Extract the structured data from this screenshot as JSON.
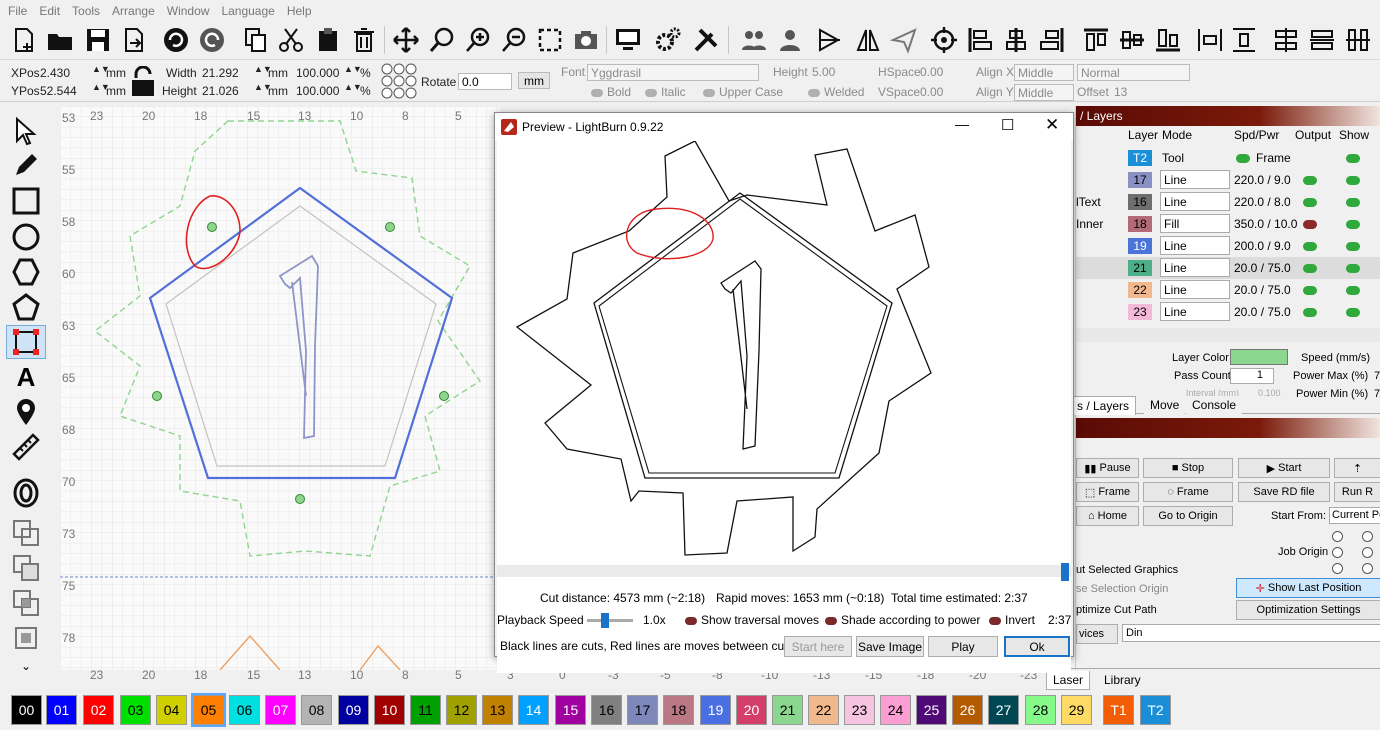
{
  "menu": [
    "File",
    "Edit",
    "Tools",
    "Arrange",
    "Window",
    "Language",
    "Help"
  ],
  "props": {
    "xpos_label": "XPos",
    "xpos": "2.430",
    "ypos_label": "YPos",
    "ypos": "52.544",
    "unit_mm": "mm",
    "width_label": "Width",
    "width": "21.292",
    "height_label": "Height",
    "height": "21.026",
    "scale_w": "100.000",
    "scale_h": "100.000",
    "pct": "%",
    "rotate_label": "Rotate",
    "rotate": "0.0",
    "mm_btn": "mm",
    "font_label": "Font",
    "font": "Yggdrasil",
    "fheight_label": "Height",
    "fheight": "5.00",
    "hspace_label": "HSpace",
    "hspace": "0.00",
    "vspace_label": "VSpace",
    "vspace": "0.00",
    "alignx_label": "Align X",
    "alignx": "Middle",
    "aligny_label": "Align Y",
    "aligny": "Middle",
    "normal": "Normal",
    "offset_label": "Offset",
    "offset": "13",
    "bold": "Bold",
    "italic": "Italic",
    "upper": "Upper Case",
    "welded": "Welded"
  },
  "ruler_top": [
    "23",
    "20",
    "18",
    "15",
    "13",
    "10",
    "8",
    "5"
  ],
  "ruler_top_bottom": [
    "23",
    "20",
    "18",
    "15",
    "13",
    "10",
    "8",
    "5",
    "3",
    "0",
    "-3",
    "-5",
    "-8",
    "-10",
    "-13",
    "-15",
    "-18",
    "-20",
    "-23"
  ],
  "ruler_left": [
    "53",
    "55",
    "58",
    "60",
    "63",
    "65",
    "68",
    "70",
    "73",
    "75",
    "78"
  ],
  "preview": {
    "title": "Preview - LightBurn 0.9.22",
    "cut_distance": "Cut distance: 4573 mm (~2:18)",
    "rapid": "Rapid moves: 1653 mm (~0:18)",
    "total": "Total time estimated: 2:37",
    "playback_label": "Playback Speed",
    "speed": "1.0x",
    "show_traversal": "Show traversal moves",
    "shade": "Shade according to power",
    "invert": "Invert",
    "time": "2:37",
    "legend": "Black lines are cuts, Red lines are moves between cuts",
    "start_here": "Start here",
    "save_image": "Save Image",
    "play": "Play",
    "ok": "Ok"
  },
  "layers": {
    "title": "/ Layers",
    "headers": [
      "Layer",
      "Mode",
      "Spd/Pwr",
      "Output",
      "Show"
    ],
    "rows": [
      {
        "name": "",
        "layer": "T2",
        "mode": "Tool",
        "spd": "Frame",
        "color": "#1a8fd8",
        "txt": "#fff"
      },
      {
        "name": "",
        "layer": "17",
        "mode": "Line",
        "spd": "220.0 / 9.0",
        "color": "#8a8fc4",
        "txt": "#000"
      },
      {
        "name": "lText",
        "layer": "16",
        "mode": "Line",
        "spd": "220.0 / 8.0",
        "color": "#6e6e6e",
        "txt": "#000"
      },
      {
        "name": "Inner",
        "layer": "18",
        "mode": "Fill",
        "spd": "350.0 / 10.0",
        "color": "#b36b7a",
        "txt": "#000"
      },
      {
        "name": "",
        "layer": "19",
        "mode": "Line",
        "spd": "200.0 / 9.0",
        "color": "#4a74d8",
        "txt": "#fff"
      },
      {
        "name": "",
        "layer": "21",
        "mode": "Line",
        "spd": "20.0 / 75.0",
        "color": "#4fae8a",
        "txt": "#000"
      },
      {
        "name": "",
        "layer": "22",
        "mode": "Line",
        "spd": "20.0 / 75.0",
        "color": "#f2b98e",
        "txt": "#000"
      },
      {
        "name": "",
        "layer": "23",
        "mode": "Line",
        "spd": "20.0 / 75.0",
        "color": "#f2b9d8",
        "txt": "#000"
      }
    ],
    "layer_color": "Layer Color",
    "speed": "Speed (mm/s)",
    "pass_count": "Pass Count",
    "pass": "1",
    "power_max": "Power Max (%)",
    "power_min": "Power Min (%)",
    "pmax": "7",
    "pmin": "7",
    "interval": "Interval (mm)",
    "interval_val": "0.100"
  },
  "tabs1": [
    "s / Layers",
    "Move",
    "Console"
  ],
  "laser": {
    "pause": "Pause",
    "stop": "Stop",
    "start": "Start",
    "frame1": "Frame",
    "frame2": "Frame",
    "save_rd": "Save RD file",
    "run_rd": "Run R",
    "home": "Home",
    "go_origin": "Go to Origin",
    "start_from": "Start From:",
    "start_from_val": "Current Po",
    "job_origin": "Job Origin",
    "cut_selected": "ut Selected Graphics",
    "use_sel": "se Selection Origin",
    "show_last": "Show Last Position",
    "optimize": "ptimize Cut Path",
    "opt_settings": "Optimization Settings",
    "devices": "vices",
    "device_val": "Din"
  },
  "tabs2": [
    "Laser",
    "Library"
  ],
  "palette": [
    {
      "l": "00",
      "c": "#000000",
      "t": "#fff"
    },
    {
      "l": "01",
      "c": "#0000ff",
      "t": "#fff"
    },
    {
      "l": "02",
      "c": "#ff0000",
      "t": "#fff"
    },
    {
      "l": "03",
      "c": "#00e000",
      "t": "#000"
    },
    {
      "l": "04",
      "c": "#d0d000",
      "t": "#000"
    },
    {
      "l": "05",
      "c": "#ff8000",
      "t": "#000"
    },
    {
      "l": "06",
      "c": "#00e0e0",
      "t": "#000"
    },
    {
      "l": "07",
      "c": "#ff00ff",
      "t": "#fff"
    },
    {
      "l": "08",
      "c": "#b4b4b4",
      "t": "#000"
    },
    {
      "l": "09",
      "c": "#0000a0",
      "t": "#fff"
    },
    {
      "l": "10",
      "c": "#a00000",
      "t": "#fff"
    },
    {
      "l": "11",
      "c": "#00a000",
      "t": "#000"
    },
    {
      "l": "12",
      "c": "#a0a000",
      "t": "#000"
    },
    {
      "l": "13",
      "c": "#c08000",
      "t": "#000"
    },
    {
      "l": "14",
      "c": "#00a0ff",
      "t": "#fff"
    },
    {
      "l": "15",
      "c": "#a000a0",
      "t": "#fff"
    },
    {
      "l": "16",
      "c": "#808080",
      "t": "#000"
    },
    {
      "l": "17",
      "c": "#7d87b9",
      "t": "#000"
    },
    {
      "l": "18",
      "c": "#bb7784",
      "t": "#000"
    },
    {
      "l": "19",
      "c": "#4a6fe3",
      "t": "#fff"
    },
    {
      "l": "20",
      "c": "#d33f6a",
      "t": "#fff"
    },
    {
      "l": "21",
      "c": "#8cd78f",
      "t": "#000"
    },
    {
      "l": "22",
      "c": "#f0b98d",
      "t": "#000"
    },
    {
      "l": "23",
      "c": "#f6c4e1",
      "t": "#000"
    },
    {
      "l": "24",
      "c": "#fa9ed4",
      "t": "#000"
    },
    {
      "l": "25",
      "c": "#500a78",
      "t": "#fff"
    },
    {
      "l": "26",
      "c": "#b45a00",
      "t": "#fff"
    },
    {
      "l": "27",
      "c": "#004754",
      "t": "#fff"
    },
    {
      "l": "28",
      "c": "#86fa88",
      "t": "#000"
    },
    {
      "l": "29",
      "c": "#ffdb66",
      "t": "#000"
    },
    {
      "l": "T1",
      "c": "#f35d05",
      "t": "#fff"
    },
    {
      "l": "T2",
      "c": "#1a8fd8",
      "t": "#fff"
    }
  ]
}
